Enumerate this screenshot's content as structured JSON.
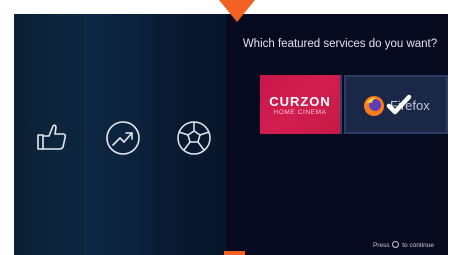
{
  "rail": {
    "icons": [
      {
        "name": "thumbs-up-icon"
      },
      {
        "name": "trending-icon"
      },
      {
        "name": "sports-ball-icon"
      }
    ],
    "chevron": "chevron-left-icon"
  },
  "panel": {
    "prompt": "Which featured services do you want?",
    "services": [
      {
        "name": "CURZON",
        "subtitle": "HOME CINEMA",
        "color": "#d21d4f"
      },
      {
        "name": "Firefox",
        "color": "#1a2747",
        "selected": true
      }
    ],
    "hint_prefix": "Press",
    "hint_suffix": "to continue",
    "hint_icon": "select-button-icon"
  },
  "colors": {
    "accent": "#f26122",
    "background": "#060a1f",
    "rail": "#0c2440"
  }
}
